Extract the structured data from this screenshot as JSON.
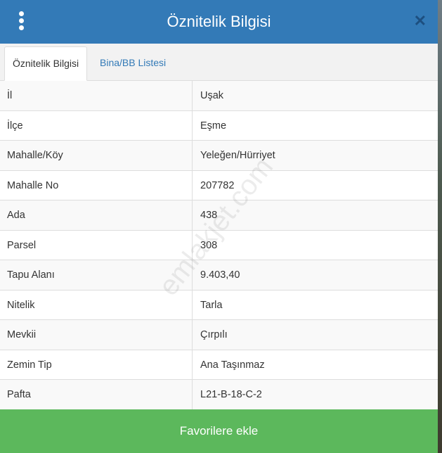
{
  "header": {
    "title": "Öznitelik Bilgisi"
  },
  "tabs": [
    {
      "label": "Öznitelik Bilgisi",
      "active": true
    },
    {
      "label": "Bina/BB Listesi",
      "active": false
    }
  ],
  "rows": [
    {
      "label": "İl",
      "value": "Uşak"
    },
    {
      "label": "İlçe",
      "value": "Eşme"
    },
    {
      "label": "Mahalle/Köy",
      "value": "Yeleğen/Hürriyet"
    },
    {
      "label": "Mahalle No",
      "value": "207782"
    },
    {
      "label": "Ada",
      "value": "438"
    },
    {
      "label": "Parsel",
      "value": "308"
    },
    {
      "label": "Tapu Alanı",
      "value": "9.403,40"
    },
    {
      "label": "Nitelik",
      "value": "Tarla"
    },
    {
      "label": "Mevkii",
      "value": "Çırpılı"
    },
    {
      "label": "Zemin Tip",
      "value": "Ana Taşınmaz"
    },
    {
      "label": "Pafta",
      "value": "L21-B-18-C-2"
    }
  ],
  "watermark": "emlakjet.com",
  "footer": {
    "button_label": "Favorilere ekle"
  },
  "colors": {
    "header": "#337ab7",
    "button": "#5cb85c",
    "link": "#337ab7"
  }
}
